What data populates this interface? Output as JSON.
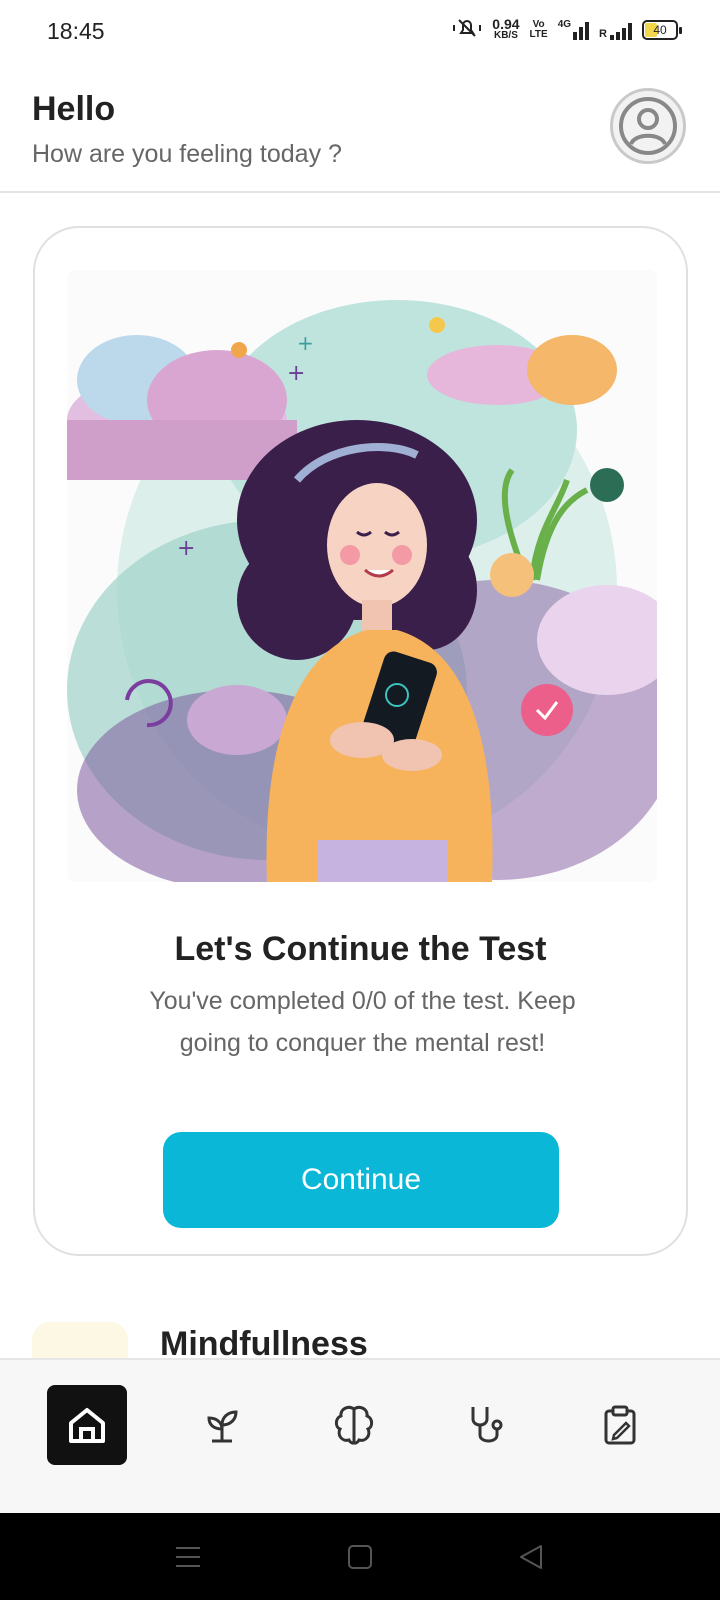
{
  "status_bar": {
    "time": "18:45",
    "net_speed_value": "0.94",
    "net_speed_unit": "KB/S",
    "volte_top": "Vo",
    "volte_bottom": "LTE",
    "network_type": "4G",
    "roaming": "R",
    "battery_level": "40"
  },
  "header": {
    "title": "Hello",
    "subtitle": "How are you feeling today ?"
  },
  "card": {
    "title": "Let's Continue the Test",
    "text": "You've completed 0/0 of the test. Keep going to conquer the mental rest!",
    "button_label": "Continue"
  },
  "next_section": {
    "title": "Mindfullness"
  },
  "bottom_nav": {
    "items": [
      {
        "icon": "home-icon",
        "active": true
      },
      {
        "icon": "sprout-icon",
        "active": false
      },
      {
        "icon": "brain-icon",
        "active": false
      },
      {
        "icon": "stethoscope-icon",
        "active": false
      },
      {
        "icon": "clipboard-icon",
        "active": false
      }
    ]
  },
  "colors": {
    "accent": "#0bb7d6",
    "nav_active": "#111111"
  }
}
